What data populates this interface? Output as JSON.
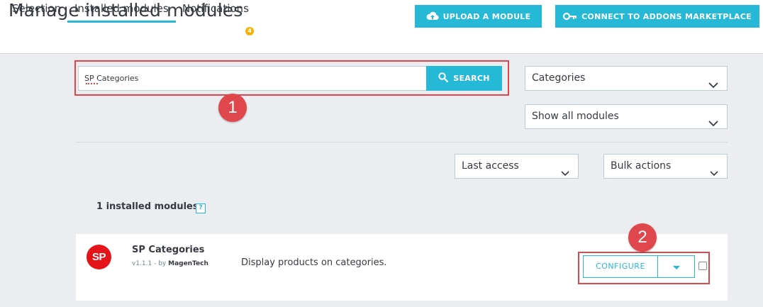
{
  "header": {
    "title": "Manage installed modules",
    "upload_button": {
      "label": "UPLOAD A MODULE",
      "icon": "cloud-upload-icon"
    },
    "connect_button": {
      "label": "CONNECT TO ADDONS MARKETPLACE",
      "icon": "key-icon"
    }
  },
  "tabs": [
    {
      "label": "Selection",
      "active": false
    },
    {
      "label": "Installed modules",
      "active": true
    },
    {
      "label": "Notifications",
      "active": false,
      "badge": "4"
    }
  ],
  "search": {
    "value": "SP Categories",
    "button_label": "SEARCH",
    "icon": "search-icon"
  },
  "filters": {
    "category_select": "Categories",
    "status_select": "Show all modules",
    "sort_select": "Last access",
    "bulk_select": "Bulk actions"
  },
  "results": {
    "count_label": "1 installed modules",
    "help_label": "?"
  },
  "module": {
    "logo_text": "SP",
    "name": "SP Categories",
    "version": "v1.1.1 - by",
    "author": "MagenTech",
    "description": "Display products on categories.",
    "configure_label": "CONFIGURE"
  },
  "annotations": {
    "marker_1": "1",
    "marker_2": "2"
  },
  "colors": {
    "primary": "#25b9d7",
    "highlight": "#e0474c",
    "badge": "#fab000",
    "module_logo": "#e5141a"
  }
}
